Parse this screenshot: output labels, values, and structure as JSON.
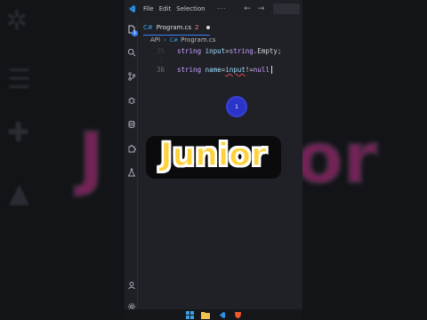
{
  "menu": {
    "file": "File",
    "edit": "Edit",
    "selection": "Selection",
    "more": "···"
  },
  "activity": {
    "badge": "1"
  },
  "tab": {
    "name": "Program.cs",
    "modified_count": "2"
  },
  "breadcrumb": {
    "folder": "API",
    "file": "Program.cs"
  },
  "code": {
    "line_top_number": "35",
    "line_top_text": {
      "kw": "string",
      "id": "input",
      "op": " = ",
      "ty": "string",
      "rest": ".Empty;"
    },
    "line_36_number": "36",
    "line_36": {
      "kw": "string",
      "id": "name",
      "op": " = ",
      "id2": "input",
      "op2": " !=",
      "nl": "null"
    }
  },
  "touch_indicator": "1",
  "overlay": {
    "title": "Junior"
  },
  "background_text": "Junior",
  "colors": {
    "accent": "#3b82f6",
    "keyword": "#c9a0ff",
    "identifier": "#9cdcfe",
    "type": "#4ec9b0"
  }
}
